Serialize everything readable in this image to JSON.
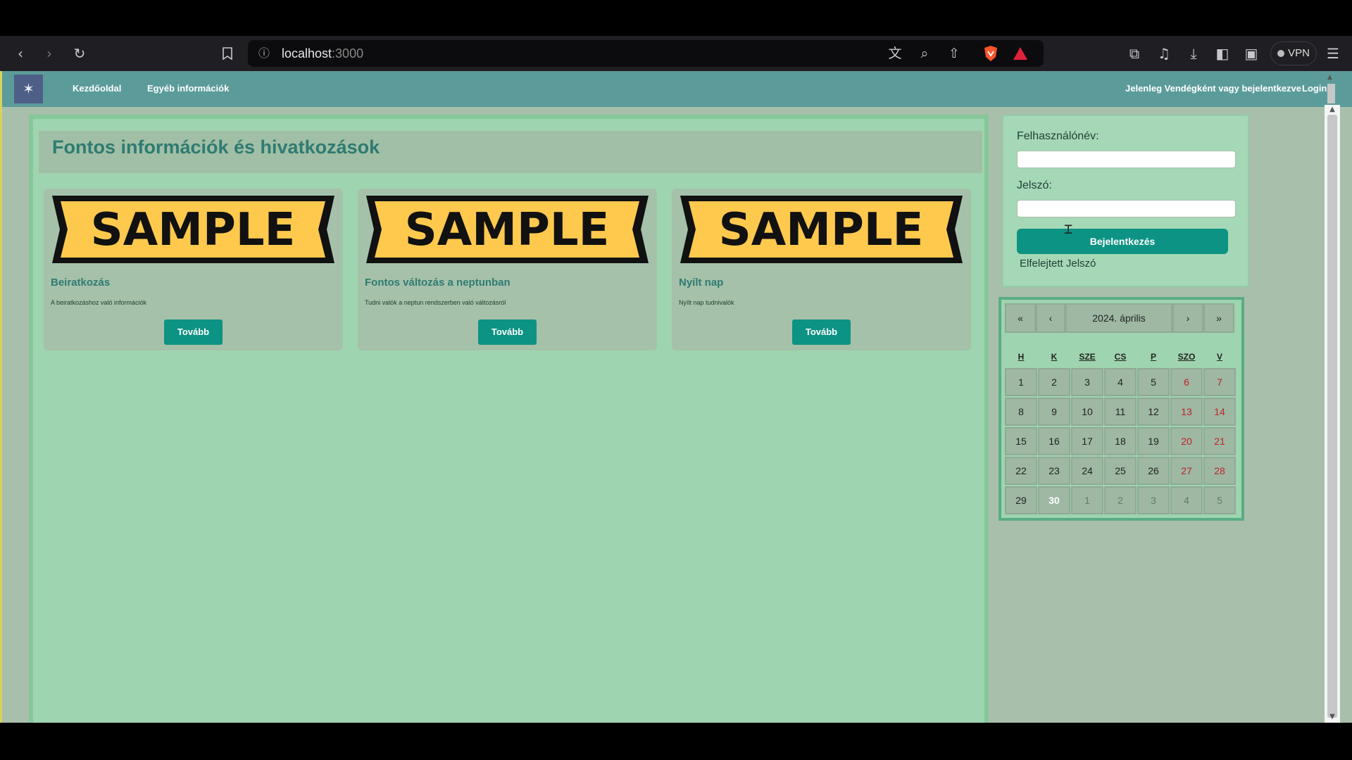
{
  "browser": {
    "url_host": "localhost",
    "url_port": ":3000",
    "vpn_label": "VPN",
    "icons": [
      "back-icon",
      "forward-icon",
      "reload-icon",
      "bookmark-icon",
      "info-icon",
      "translate-icon",
      "zoom-icon",
      "share-icon",
      "brave-shield-icon",
      "rewards-icon",
      "extensions-icon",
      "media-icon",
      "download-icon",
      "sidebar-icon",
      "wallet-icon",
      "menu-icon"
    ]
  },
  "navbar": {
    "links": [
      "Kezdőoldal",
      "Egyéb információk"
    ],
    "status": "Jelenleg Vendégként vagy bejelentkezve",
    "login": "Login"
  },
  "main": {
    "title": "Fontos információk és hivatkozások",
    "sample_text": "SAMPLE",
    "cards": [
      {
        "title": "Beiratkozás",
        "text": "A beiratkozáshoz való információk",
        "button": "Tovább"
      },
      {
        "title": "Fontos változás a neptunban",
        "text": "Tudni valók a neptun rendszerben való változásról",
        "button": "Tovább"
      },
      {
        "title": "Nyílt nap",
        "text": "Nyílt nap tudnivalók",
        "button": "Tovább"
      }
    ]
  },
  "login": {
    "username_label": "Felhasználónév:",
    "password_label": "Jelszó:",
    "submit": "Bejelentkezés",
    "forgot": "Elfelejtett Jelszó"
  },
  "calendar": {
    "nav": {
      "prev2": "«",
      "prev": "‹",
      "label": "2024. április",
      "next": "›",
      "next2": "»"
    },
    "weekdays": [
      "H",
      "K",
      "SZE",
      "CS",
      "P",
      "SZO",
      "V"
    ],
    "weeks": [
      [
        "1",
        "2",
        "3",
        "4",
        "5",
        "6",
        "7"
      ],
      [
        "8",
        "9",
        "10",
        "11",
        "12",
        "13",
        "14"
      ],
      [
        "15",
        "16",
        "17",
        "18",
        "19",
        "20",
        "21"
      ],
      [
        "22",
        "23",
        "24",
        "25",
        "26",
        "27",
        "28"
      ],
      [
        "29",
        "30",
        "1",
        "2",
        "3",
        "4",
        "5"
      ]
    ],
    "today": "30"
  },
  "colors": {
    "accent": "#0d9384",
    "navbar": "#5b9c9a",
    "weekend": "#c0232a"
  }
}
